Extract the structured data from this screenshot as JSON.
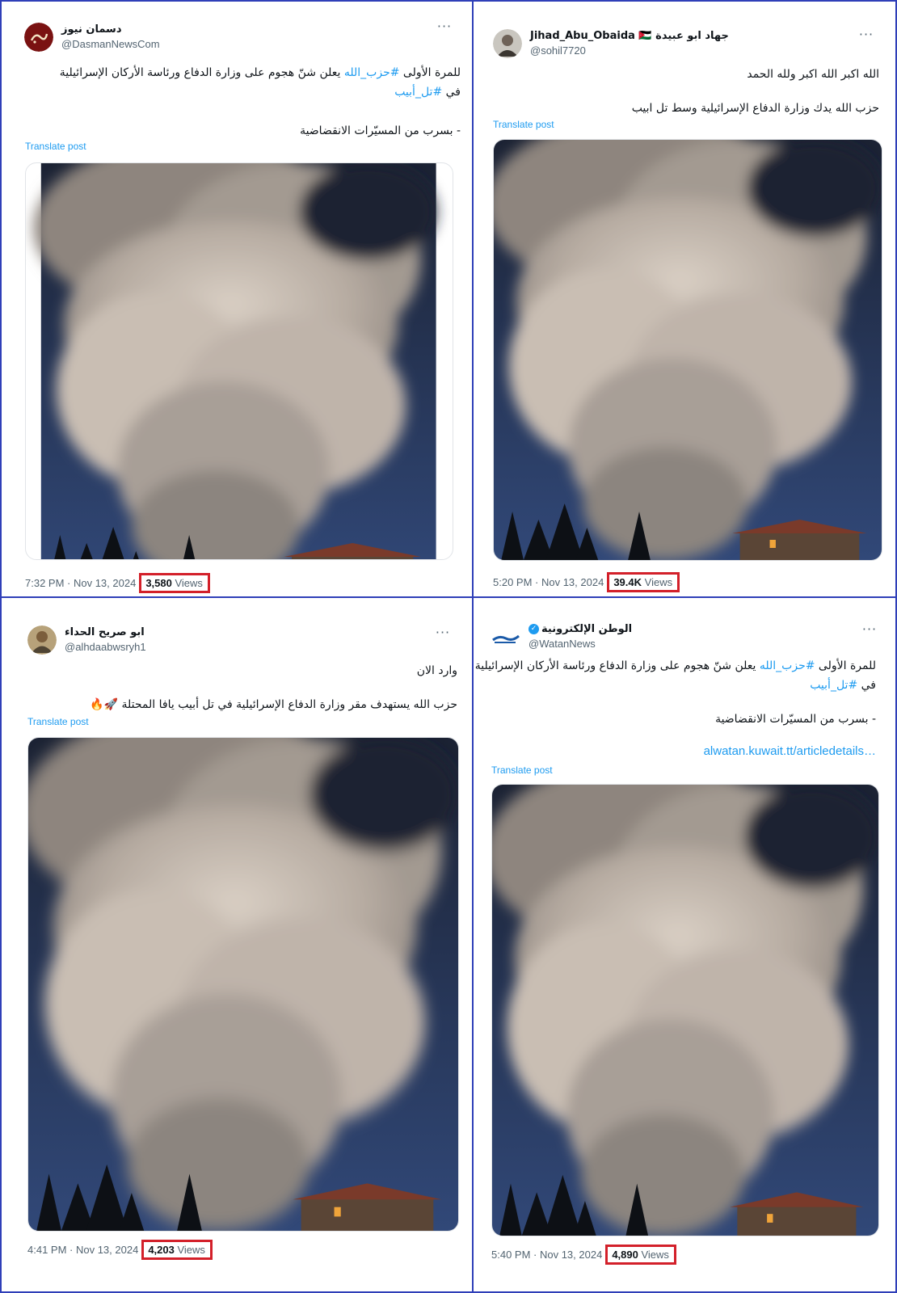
{
  "colors": {
    "divider": "#2f3fb8",
    "highlight": "#d3202a",
    "link": "#1d9bf0"
  },
  "posts": [
    {
      "name": "دسمان نيوز",
      "handle": "@DasmanNewsCom",
      "avatar_icon": "dasman-logo-icon",
      "lines": [
        {
          "parts": [
            "للمرة الأولى ",
            "#حزب_الله",
            " يعلن شنّ هجوم على وزارة الدفاع ورئاسة الأركان الإسرائيلية"
          ]
        },
        {
          "parts": [
            "في ",
            "#تل_أبيب",
            ""
          ]
        },
        {
          "parts": [
            "- بسرب من المسيّرات الانقضاضية",
            "",
            ""
          ]
        }
      ],
      "translate": "Translate post",
      "time": "7:32 PM · Nov 13, 2024",
      "views_count": "3,580",
      "views_label": "Views"
    },
    {
      "name": "Jihad_Abu_Obaida 🇯🇴 جهاد ابو عبيدة",
      "handle": "@sohil7720",
      "avatar_icon": "portrait-avatar-icon",
      "lines": [
        {
          "parts": [
            "الله اكبر الله اكبر ولله الحمد",
            "",
            ""
          ]
        },
        {
          "parts": [
            "حزب الله يدك وزارة الدفاع الإسرائيلية وسط تل ابيب",
            "",
            ""
          ]
        }
      ],
      "translate": "Translate post",
      "time": "5:20 PM · Nov 13, 2024",
      "views_count": "39.4K",
      "views_label": "Views"
    },
    {
      "name": "ابو صريح الحداء",
      "handle": "@alhdaabwsryh1",
      "avatar_icon": "portrait-avatar-icon",
      "lines": [
        {
          "parts": [
            "وارد الان",
            "",
            ""
          ]
        },
        {
          "parts": [
            "حزب الله  يستهدف مقر وزارة الدفاع الإسرائيلية في تل أبيب يافا المحتلة 🚀🔥",
            "",
            ""
          ]
        }
      ],
      "translate": "Translate post",
      "time": "4:41 PM · Nov 13, 2024",
      "views_count": "4,203",
      "views_label": "Views"
    },
    {
      "name": "الوطن الإلكترونية",
      "handle": "@WatanNews",
      "avatar_icon": "alwatan-logo-icon",
      "lines": [
        {
          "parts": [
            "للمرة الأولى ",
            "#حزب_الله",
            " يعلن شنّ هجوم على وزارة الدفاع ورئاسة الأركان الإسرائيلية"
          ]
        },
        {
          "parts": [
            "في ",
            "#تل_أبيب",
            ""
          ]
        },
        {
          "parts": [
            "- بسرب من المسيّرات الانقضاضية",
            "",
            ""
          ]
        }
      ],
      "link": "alwatan.kuwait.tt/articledetails…",
      "translate": "Translate post",
      "time": "5:40 PM · Nov 13, 2024",
      "views_count": "4,890",
      "views_label": "Views"
    }
  ]
}
